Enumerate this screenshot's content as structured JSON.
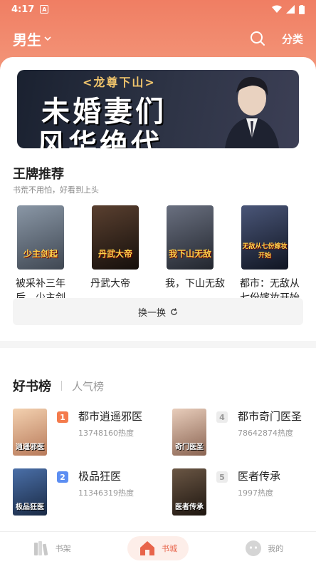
{
  "status": {
    "time": "4:17",
    "notif_glyph": "A"
  },
  "topnav": {
    "gender_label": "男生",
    "category_label": "分类"
  },
  "banner": {
    "subtitle": "<龙尊下山>",
    "line1": "未婚妻们",
    "line2": "风华绝代"
  },
  "recommend": {
    "title": "王牌推荐",
    "subtitle": "书荒不用怕，好看到上头",
    "books": [
      {
        "title": "被采补三年后，少主剑...",
        "cover_text": "少主剑起",
        "cover_color": "#5a6470"
      },
      {
        "title": "丹武大帝",
        "cover_text": "丹武大帝",
        "cover_color": "#2a1f1a"
      },
      {
        "title": "我，下山无敌",
        "cover_text": "我下山无敌",
        "cover_color": "#3a3f4a"
      },
      {
        "title": "都市：无敌从七份嫁妆开始",
        "cover_text": "无敌从七份嫁妆开始",
        "cover_color": "#1f2638"
      }
    ],
    "swap_label": "换一换"
  },
  "ranking": {
    "tab_active": "好书榜",
    "tab_other": "人气榜",
    "items": [
      {
        "rank": "1",
        "name": "都市逍遥邪医",
        "heat": "13748160热度",
        "badge_color": "#f47b4c",
        "cover_text": "逍遥邪医",
        "cover_color": "#d9a079"
      },
      {
        "rank": "2",
        "name": "极品狂医",
        "heat": "11346319热度",
        "badge_color": "#5c8ef2",
        "cover_text": "极品狂医",
        "cover_color": "#2b4a7a"
      },
      {
        "rank": "4",
        "name": "都市奇门医圣",
        "heat": "78642874热度",
        "badge_color": "#e8e8e8",
        "cover_text": "奇门医圣",
        "cover_color": "#c7a18c"
      },
      {
        "rank": "5",
        "name": "医者传承",
        "heat": "1997热度",
        "badge_color": "#e8e8e8",
        "cover_text": "医者传承",
        "cover_color": "#3a2e25"
      }
    ]
  },
  "bottom_nav": {
    "shelf_label": "书架",
    "store_label": "书城",
    "mine_label": "我的"
  }
}
